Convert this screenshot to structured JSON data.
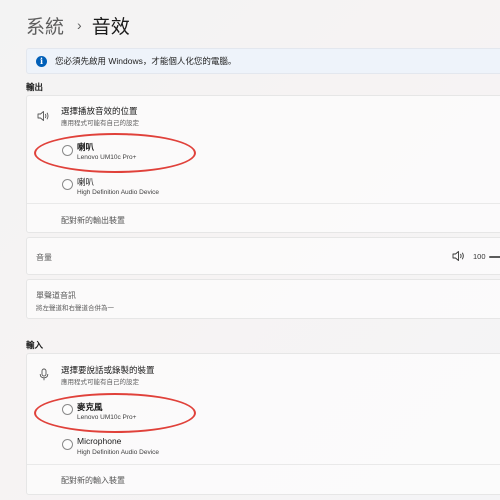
{
  "breadcrumb": {
    "parent": "系統",
    "separator": "›",
    "current": "音效"
  },
  "notice": {
    "text": "您必須先啟用 Windows，才能個人化您的電腦。"
  },
  "output": {
    "section_title": "輸出",
    "choose_title": "選擇播放音效的位置",
    "choose_sub": "應用程式可能有自己的設定",
    "devices": [
      {
        "name": "喇叭",
        "description": "Lenovo UM10c Pro+"
      },
      {
        "name": "喇叭",
        "description": "High Definition Audio Device"
      }
    ],
    "pair_new": "配對新的輸出裝置",
    "volume_label": "音量",
    "volume_value": "100",
    "mono_title": "單聲道音訊",
    "mono_sub": "將左聲道和右聲道合併為一"
  },
  "input": {
    "section_title": "輸入",
    "choose_title": "選擇要說話或錄製的裝置",
    "choose_sub": "應用程式可能有自己的設定",
    "devices": [
      {
        "name": "麥克風",
        "description": "Lenovo UM10c Pro+"
      },
      {
        "name": "Microphone",
        "description": "High Definition Audio Device"
      }
    ],
    "pair_new": "配對新的輸入裝置"
  },
  "icons": {
    "info": "info-icon",
    "speaker": "speaker-icon",
    "microphone": "microphone-icon",
    "volume": "volume-icon"
  },
  "colors": {
    "accent": "#005fb8",
    "annotation": "#e0413a"
  }
}
